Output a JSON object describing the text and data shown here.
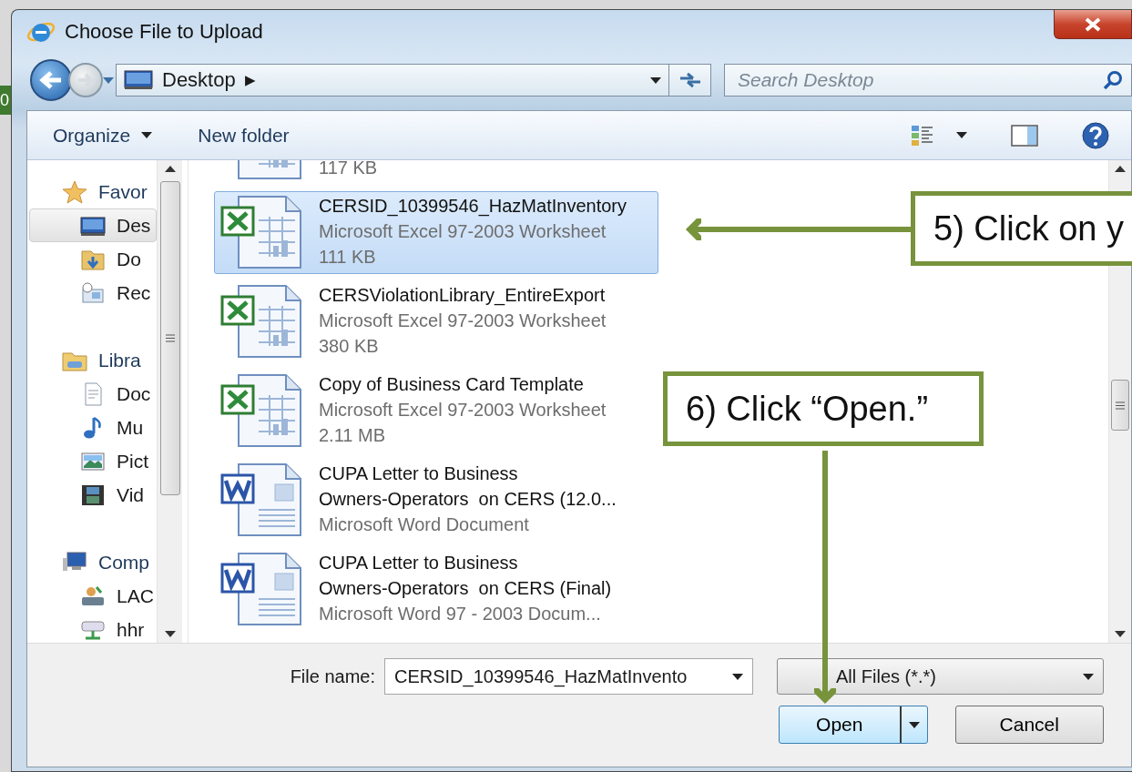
{
  "background": {
    "text": "0"
  },
  "window": {
    "title": "Choose File to Upload"
  },
  "address_bar": {
    "location": "Desktop",
    "separator": "▶"
  },
  "search": {
    "placeholder": "Search Desktop"
  },
  "toolbar": {
    "buttons": [
      {
        "label": "Organize",
        "dropdown": true
      },
      {
        "label": "New folder",
        "dropdown": false
      }
    ]
  },
  "nav_pane": {
    "groups": [
      {
        "label": "Favor",
        "kind": "star",
        "children": [
          {
            "label": "Des",
            "kind": "desktop",
            "selected": true
          },
          {
            "label": "Do",
            "kind": "downloads",
            "selected": false
          },
          {
            "label": "Rec",
            "kind": "recent",
            "selected": false
          }
        ]
      },
      {
        "label": "Libra",
        "kind": "library",
        "children": [
          {
            "label": "Doc",
            "kind": "documents",
            "selected": false
          },
          {
            "label": "Mu",
            "kind": "music",
            "selected": false
          },
          {
            "label": "Pict",
            "kind": "pictures",
            "selected": false
          },
          {
            "label": "Vid",
            "kind": "videos",
            "selected": false
          }
        ]
      },
      {
        "label": "Comp",
        "kind": "computer",
        "children": [
          {
            "label": "LAC",
            "kind": "drive",
            "selected": false
          },
          {
            "label": "hhr",
            "kind": "network",
            "selected": false
          }
        ]
      }
    ]
  },
  "files": [
    {
      "kind": "excel",
      "size": "117 KB",
      "selected": false
    },
    {
      "kind": "excel",
      "name_lines": [
        "CERSID_10399546_HazMatInventory"
      ],
      "type": "Microsoft Excel 97-2003 Worksheet",
      "size": "111 KB",
      "selected": true
    },
    {
      "kind": "excel",
      "name_lines": [
        "CERSViolationLibrary_EntireExport"
      ],
      "type": "Microsoft Excel 97-2003 Worksheet",
      "size": "380 KB",
      "selected": false
    },
    {
      "kind": "excel",
      "name_lines": [
        "Copy of Business Card Template"
      ],
      "type": "Microsoft Excel 97-2003 Worksheet",
      "size": "2.11 MB",
      "selected": false
    },
    {
      "kind": "word",
      "name_lines": [
        "CUPA Letter to Business",
        "Owners-Operators  on CERS (12.0..."
      ],
      "type": "Microsoft Word Document",
      "selected": false
    },
    {
      "kind": "word",
      "name_lines": [
        "CUPA Letter to Business",
        "Owners-Operators  on CERS (Final)"
      ],
      "type": "Microsoft Word 97 - 2003 Docum...",
      "selected": false
    }
  ],
  "file_name": {
    "label": "File name:",
    "value": "CERSID_10399546_HazMatInvento"
  },
  "file_type": {
    "value": "All Files (*.*)"
  },
  "buttons": [
    {
      "label": "Open",
      "split": true
    },
    {
      "label": "Cancel",
      "split": false
    }
  ],
  "callouts": [
    {
      "text": "5) Click on y"
    },
    {
      "text": "6) Click “Open.”"
    }
  ]
}
